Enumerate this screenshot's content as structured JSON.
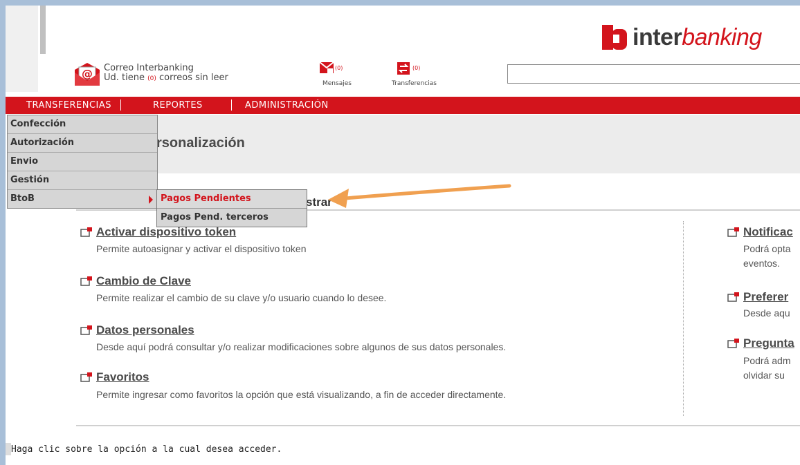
{
  "brand": {
    "part1": "inter",
    "part2": "banking"
  },
  "correo": {
    "title": "Correo Interbanking",
    "line_prefix": "Ud. tiene",
    "count": "(0)",
    "line_suffix": "correos sin leer"
  },
  "indicators": [
    {
      "label": "Mensajes",
      "count": "(0)"
    },
    {
      "label": "Transferencias",
      "count": "(0)"
    }
  ],
  "menu": [
    "TRANSFERENCIAS",
    "REPORTES",
    "ADMINISTRACIÓN"
  ],
  "dropdown": [
    "Confección",
    "Autorización",
    "Envio",
    "Gestión",
    "BtoB"
  ],
  "submenu": [
    "Pagos Pendientes",
    "Pagos Pend. terceros"
  ],
  "page_title": "rsonalización",
  "section_title": "strar",
  "options_left": [
    {
      "title": "Activar dispositivo token",
      "desc": "Permite autoasignar y activar el dispositivo token"
    },
    {
      "title": "Cambio de Clave",
      "desc": "Permite realizar el cambio de su clave y/o usuario cuando lo desee."
    },
    {
      "title": "Datos personales",
      "desc": "Desde aquí podrá consultar y/o realizar modificaciones sobre algunos de sus datos personales."
    },
    {
      "title": "Favoritos",
      "desc": "Permite ingresar como favoritos la opción que está visualizando, a fin de acceder directamente."
    }
  ],
  "options_right": [
    {
      "title": "Notificac",
      "desc1": "Podrá opta",
      "desc2": "eventos."
    },
    {
      "title": "Preferer",
      "desc1": "Desde aqu",
      "desc2": ""
    },
    {
      "title": "Pregunta",
      "desc1": "Podrá adm",
      "desc2": "olvidar su"
    }
  ],
  "footer": "Haga clic sobre la opción a la cual desea acceder.",
  "colors": {
    "brand_red": "#d3141c",
    "menu_gray": "#d6d6d6",
    "arrow_orange": "#f0a050"
  }
}
